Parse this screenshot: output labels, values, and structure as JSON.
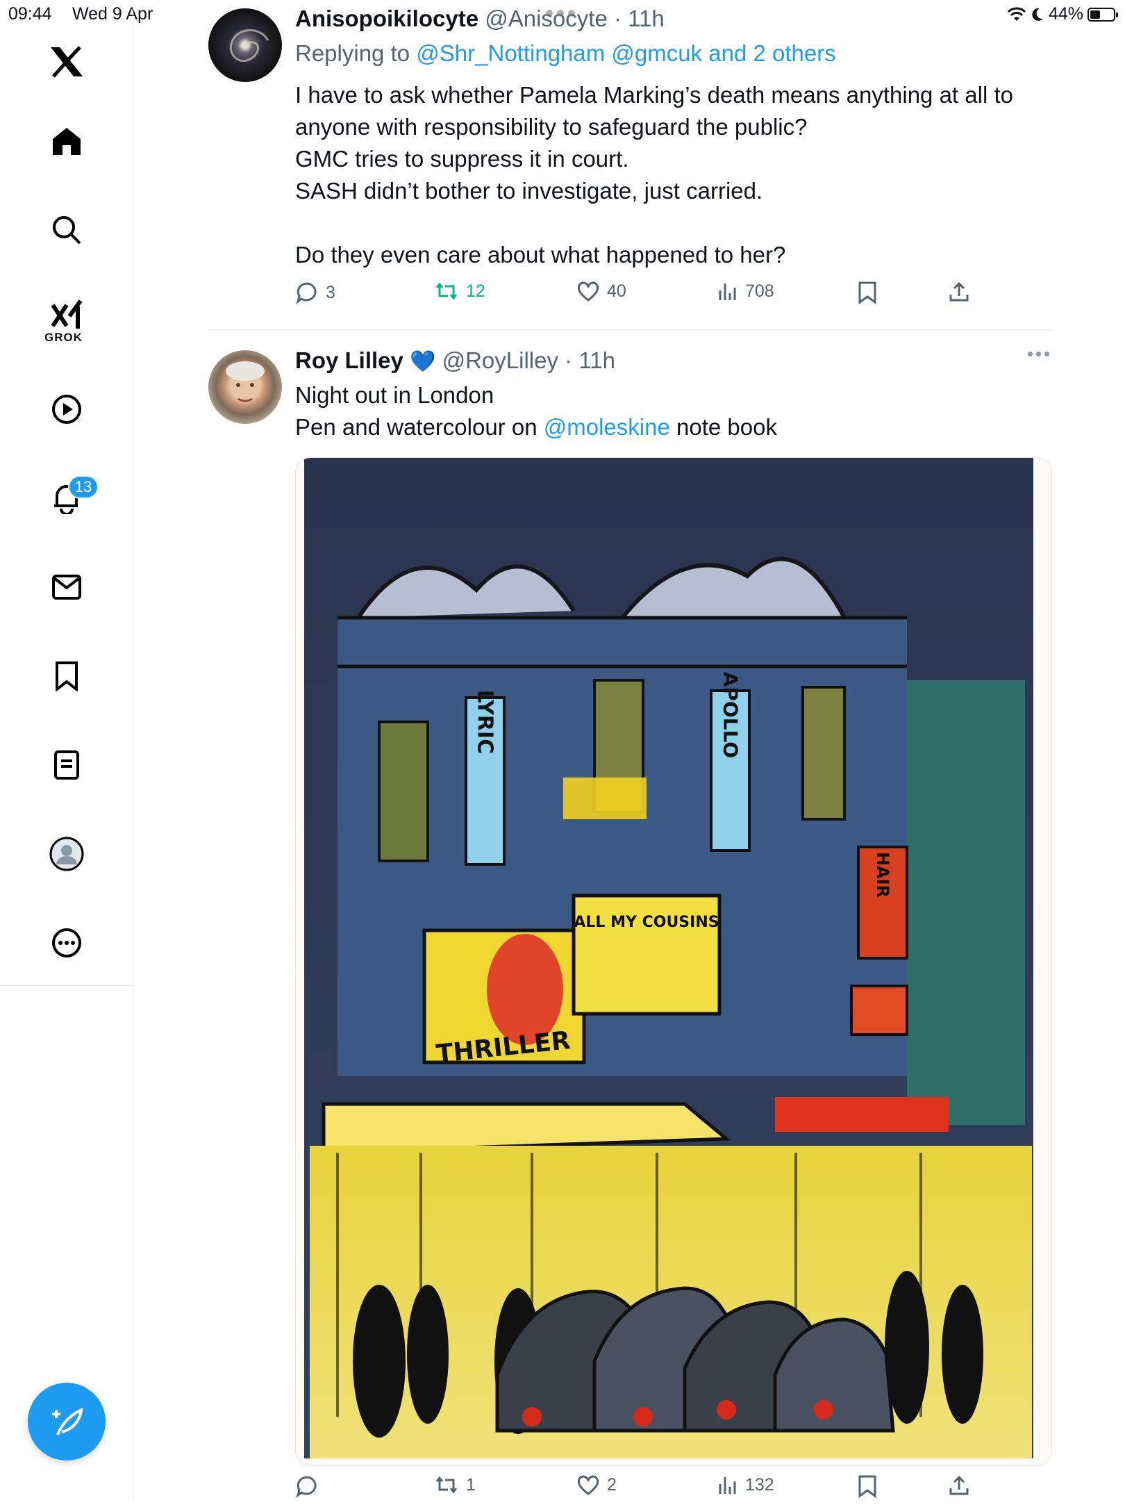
{
  "status_bar": {
    "time": "09:44",
    "date": "Wed 9 Apr",
    "battery": "44%",
    "battery_level": 0.44
  },
  "sidebar": {
    "grok_label": "GROK",
    "notifications_count": "13",
    "items": [
      {
        "name": "x-logo",
        "icon": "x-logo-icon"
      },
      {
        "name": "home",
        "icon": "home-icon"
      },
      {
        "name": "explore",
        "icon": "search-icon"
      },
      {
        "name": "grok",
        "icon": "grok-icon"
      },
      {
        "name": "videos",
        "icon": "play-icon"
      },
      {
        "name": "notifications",
        "icon": "bell-icon"
      },
      {
        "name": "messages",
        "icon": "mail-icon"
      },
      {
        "name": "bookmarks",
        "icon": "bookmark-icon"
      },
      {
        "name": "lists",
        "icon": "list-icon"
      },
      {
        "name": "profile",
        "icon": "profile-icon"
      },
      {
        "name": "more",
        "icon": "more-icon"
      }
    ]
  },
  "tweets": [
    {
      "name": "Anisopoikilocyte",
      "handle": "@Anisocyte",
      "time": "11h",
      "replying_prefix": "Replying to",
      "replying_to": "@Shr_Nottingham @gmcuk and 2 others",
      "lines": [
        "I have to ask whether Pamela Marking’s death means anything at all to",
        "anyone with responsibility to safeguard the public?",
        "GMC tries to suppress it in court.",
        "SASH didn’t bother to investigate, just carried.",
        "Do they even care about what happened to her?"
      ],
      "replies": "3",
      "reposts": "12",
      "likes": "40",
      "views": "708"
    },
    {
      "name": "Roy Lilley",
      "badge": "💙",
      "handle": "@RoyLilley",
      "time": "11h",
      "line1": "Night out in London",
      "line2_prefix": "Pen and watercolour on",
      "line2_mention": "@moleskine",
      "line2_suffix": "note book",
      "sign_left": "LYRIC",
      "sign_right": "APOLLO",
      "poster_left": "THRILLER",
      "poster_right": "ALL MY COUSINS",
      "side_sign": "HAIR",
      "replies": "",
      "reposts": "1",
      "likes": "2",
      "views": "132"
    }
  ],
  "colors": {
    "accent": "#1d9bf0",
    "repost": "#00ba7c",
    "muted": "#536471",
    "text": "#0f1419"
  }
}
